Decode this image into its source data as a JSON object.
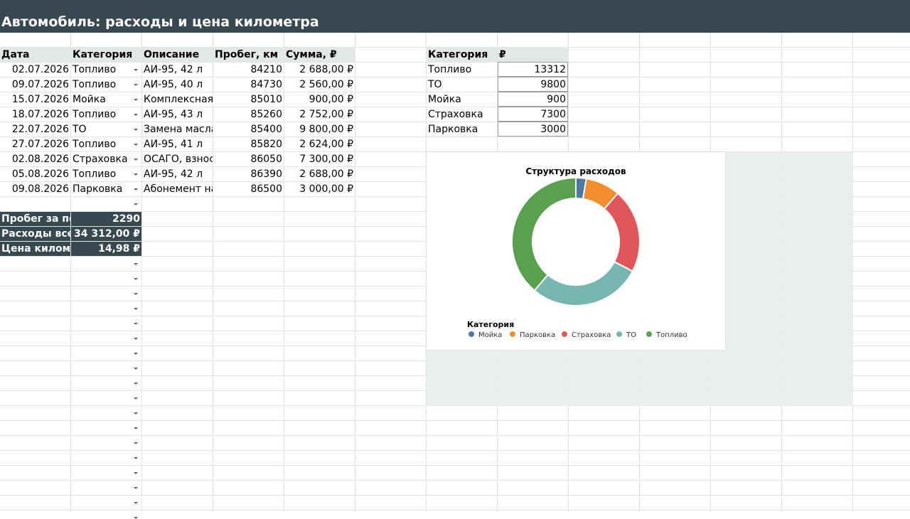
{
  "title": "Автомобиль: расходы и цена километра",
  "expenses": {
    "headers": [
      "Дата",
      "Категория",
      "Описание",
      "Пробег, км",
      "Сумма, ₽"
    ],
    "rows": [
      [
        "02.07.2026",
        "Топливо",
        "АИ-95, 42 л",
        "84210",
        "2 688,00 ₽"
      ],
      [
        "09.07.2026",
        "Топливо",
        "АИ-95, 40 л",
        "84730",
        "2 560,00 ₽"
      ],
      [
        "15.07.2026",
        "Мойка",
        "Комплексная",
        "85010",
        "900,00 ₽"
      ],
      [
        "18.07.2026",
        "Топливо",
        "АИ-95, 43 л",
        "85260",
        "2 752,00 ₽"
      ],
      [
        "22.07.2026",
        "ТО",
        "Замена масла",
        "85400",
        "9 800,00 ₽"
      ],
      [
        "27.07.2026",
        "Топливо",
        "АИ-95, 41 л",
        "85820",
        "2 624,00 ₽"
      ],
      [
        "02.08.2026",
        "Страховка",
        "ОСАГО, взнос",
        "86050",
        "7 300,00 ₽"
      ],
      [
        "05.08.2026",
        "Топливо",
        "АИ-95, 42 л",
        "86390",
        "2 688,00 ₽"
      ],
      [
        "09.08.2026",
        "Парковка",
        "Абонемент на",
        "86500",
        "3 000,00 ₽"
      ]
    ]
  },
  "summary": [
    {
      "label": "Пробег за пе",
      "value": "2290"
    },
    {
      "label": "Расходы всег",
      "value": "34 312,00 ₽"
    },
    {
      "label": "Цена киломе",
      "value": "14,98 ₽"
    }
  ],
  "pivot": {
    "headers": [
      "Категория",
      "₽"
    ],
    "rows": [
      [
        "Топливо",
        "13312"
      ],
      [
        "ТО",
        "9800"
      ],
      [
        "Мойка",
        "900"
      ],
      [
        "Страховка",
        "7300"
      ],
      [
        "Парковка",
        "3000"
      ]
    ]
  },
  "colors": {
    "header_bg": "#374850",
    "grid_line": "#e2e3e3",
    "header_row_bg": "#e4e7e8",
    "summary_bg": "#374850",
    "Мойка": "#4e79a7",
    "Парковка": "#f28e2b",
    "Страховка": "#e15759",
    "ТО": "#76b7b2",
    "Топливо": "#59a14f"
  },
  "chart_data": {
    "type": "pie",
    "donut": true,
    "title": "Структура расходов",
    "legend_title": "Категория",
    "legend_position": "bottom-left",
    "categories": [
      "Мойка",
      "Парковка",
      "Страховка",
      "ТО",
      "Топливо"
    ],
    "values": [
      900,
      3000,
      7300,
      9800,
      13312
    ]
  }
}
